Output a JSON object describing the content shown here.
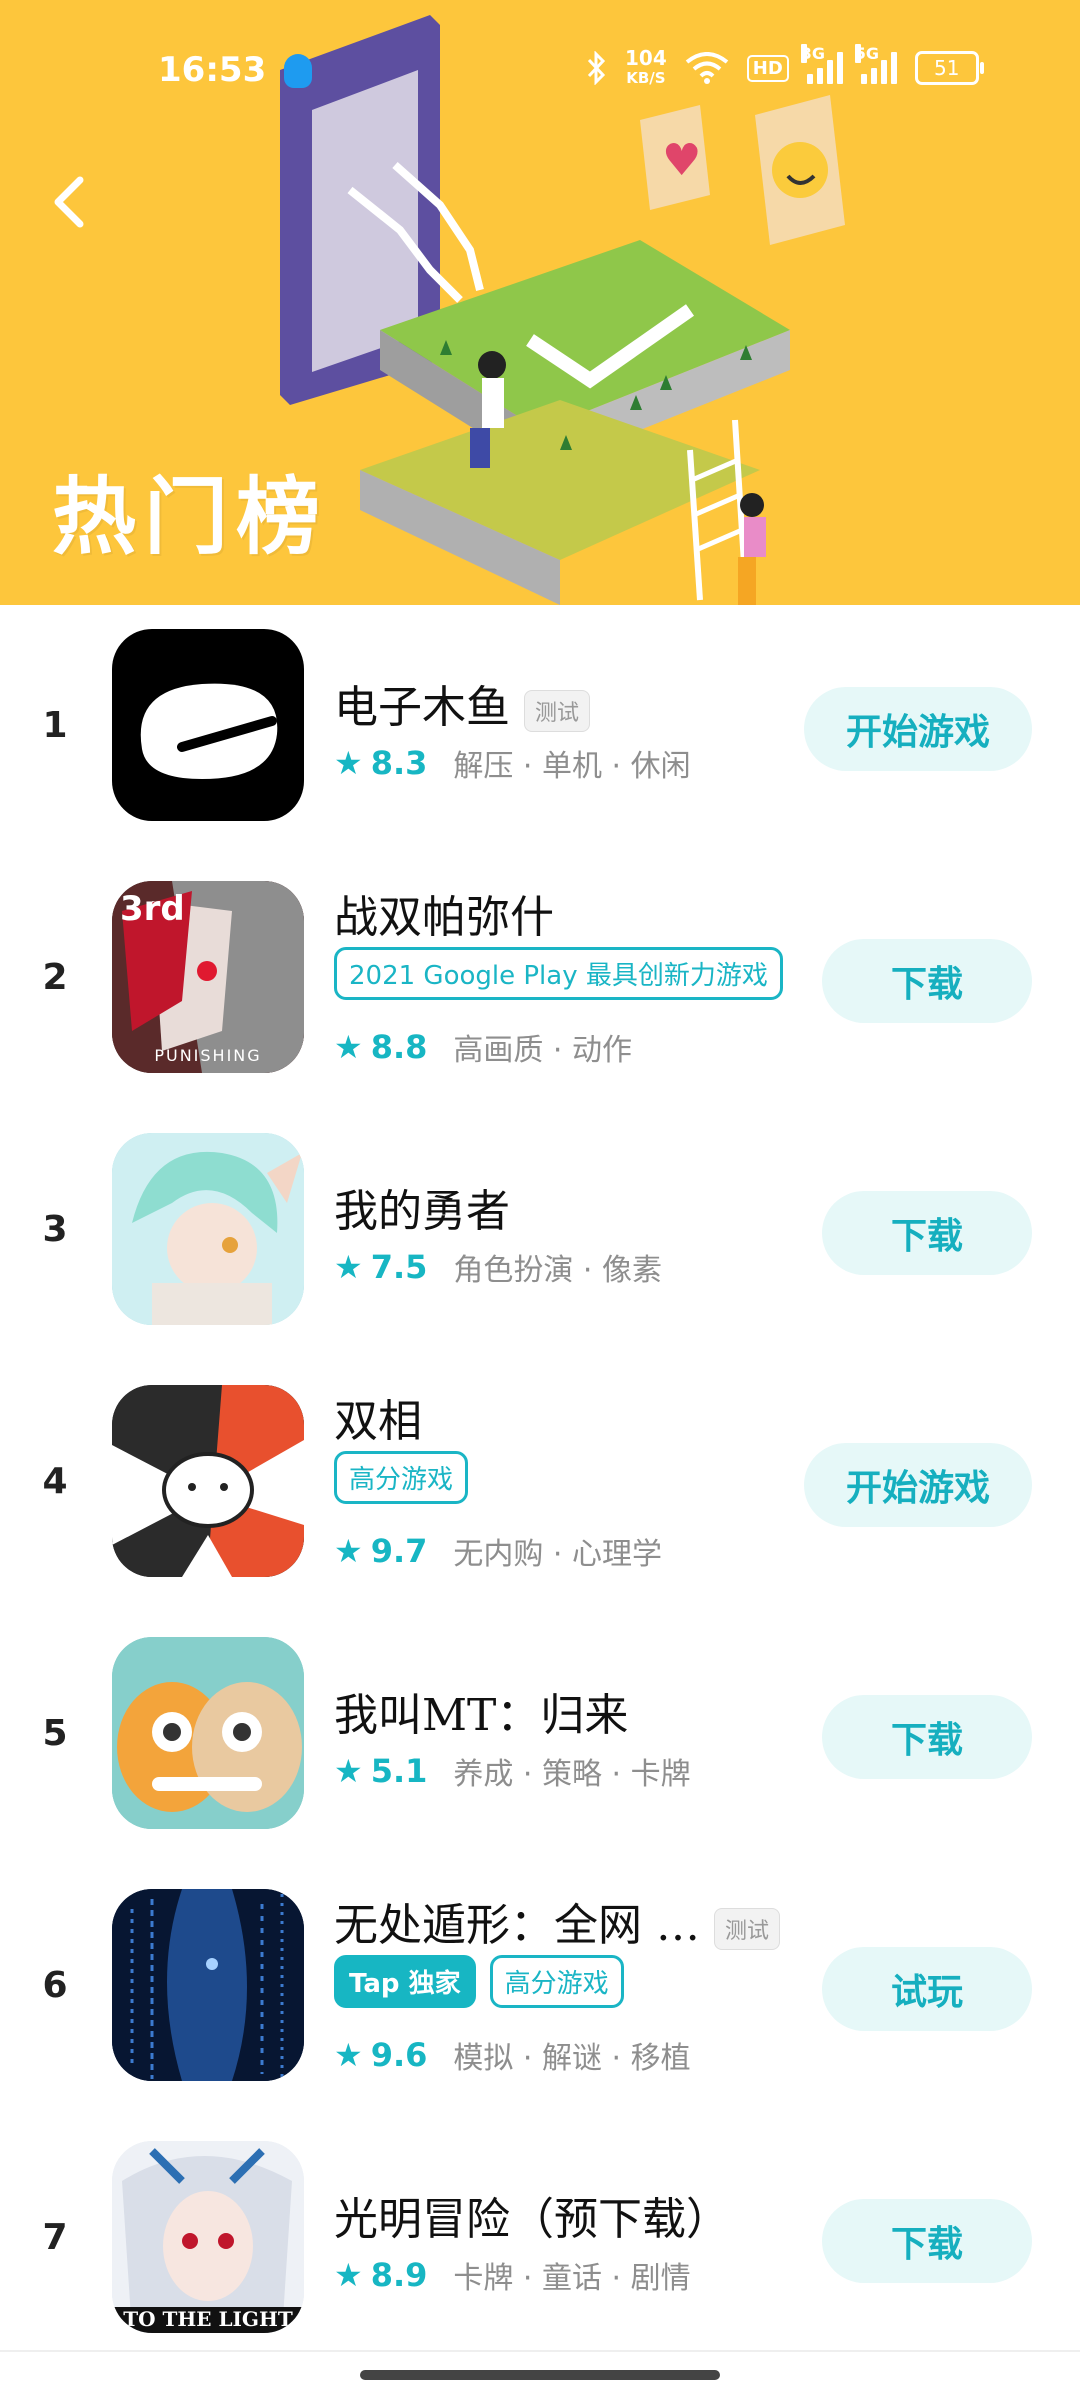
{
  "status_bar": {
    "time": "16:53",
    "net_speed": "104",
    "net_unit": "KB/S",
    "hd": "HD",
    "gen1": "3G",
    "gen2": "5G",
    "battery": "51"
  },
  "header": {
    "title": "热门榜",
    "back_icon": "chevron-left-icon",
    "background_color": "#FDC63C"
  },
  "accent_color": "#17B6C3",
  "games": [
    {
      "rank": "1",
      "name": "电子木鱼",
      "tag": "测试",
      "badges": [],
      "score": "8.3",
      "genres": "解压 · 单机 · 休闲",
      "action": "开始游戏"
    },
    {
      "rank": "2",
      "name": "战双帕弥什",
      "tag": "",
      "badges": [
        "2021 Google Play 最具创新力游戏"
      ],
      "score": "8.8",
      "genres": "高画质 · 动作",
      "action": "下载",
      "icon_text_top": "3rd",
      "icon_text_bottom": "PUNISHING"
    },
    {
      "rank": "3",
      "name": "我的勇者",
      "tag": "",
      "badges": [],
      "score": "7.5",
      "genres": "角色扮演 · 像素",
      "action": "下载"
    },
    {
      "rank": "4",
      "name": "双相",
      "tag": "",
      "badges": [
        "高分游戏"
      ],
      "score": "9.7",
      "genres": "无内购 · 心理学",
      "action": "开始游戏"
    },
    {
      "rank": "5",
      "name": "我叫MT：归来",
      "tag": "",
      "badges": [],
      "score": "5.1",
      "genres": "养成 · 策略 · 卡牌",
      "action": "下载"
    },
    {
      "rank": "6",
      "name": "无处遁形：全网 …",
      "tag": "测试",
      "badges": [
        "Tap 独家",
        "高分游戏"
      ],
      "score": "9.6",
      "genres": "模拟 · 解谜 · 移植",
      "action": "试玩"
    },
    {
      "rank": "7",
      "name": "光明冒险（预下载）",
      "tag": "",
      "badges": [],
      "score": "8.9",
      "genres": "卡牌 · 童话 · 剧情",
      "action": "下载",
      "icon_text_bottom": "TO THE LIGHT"
    }
  ]
}
